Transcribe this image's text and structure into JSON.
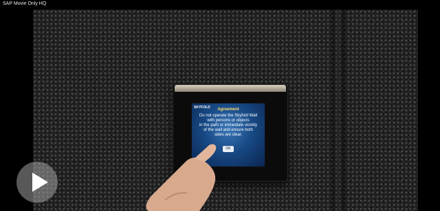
{
  "window": {
    "title": "SAP Movie Only HQ"
  },
  "screen": {
    "logo": "SKYFOLD",
    "title": "Agreement",
    "message_lines": [
      "Do not operate the Skyfold Wall",
      "with persons or objects",
      "in the path or immediate vicinity",
      "of the wall and ensure both",
      "sides are clear."
    ],
    "button": "OK"
  },
  "player": {
    "play_icon": "play-icon"
  },
  "colors": {
    "accent_title": "#ffd86a",
    "screen_blue": "#184a86"
  }
}
